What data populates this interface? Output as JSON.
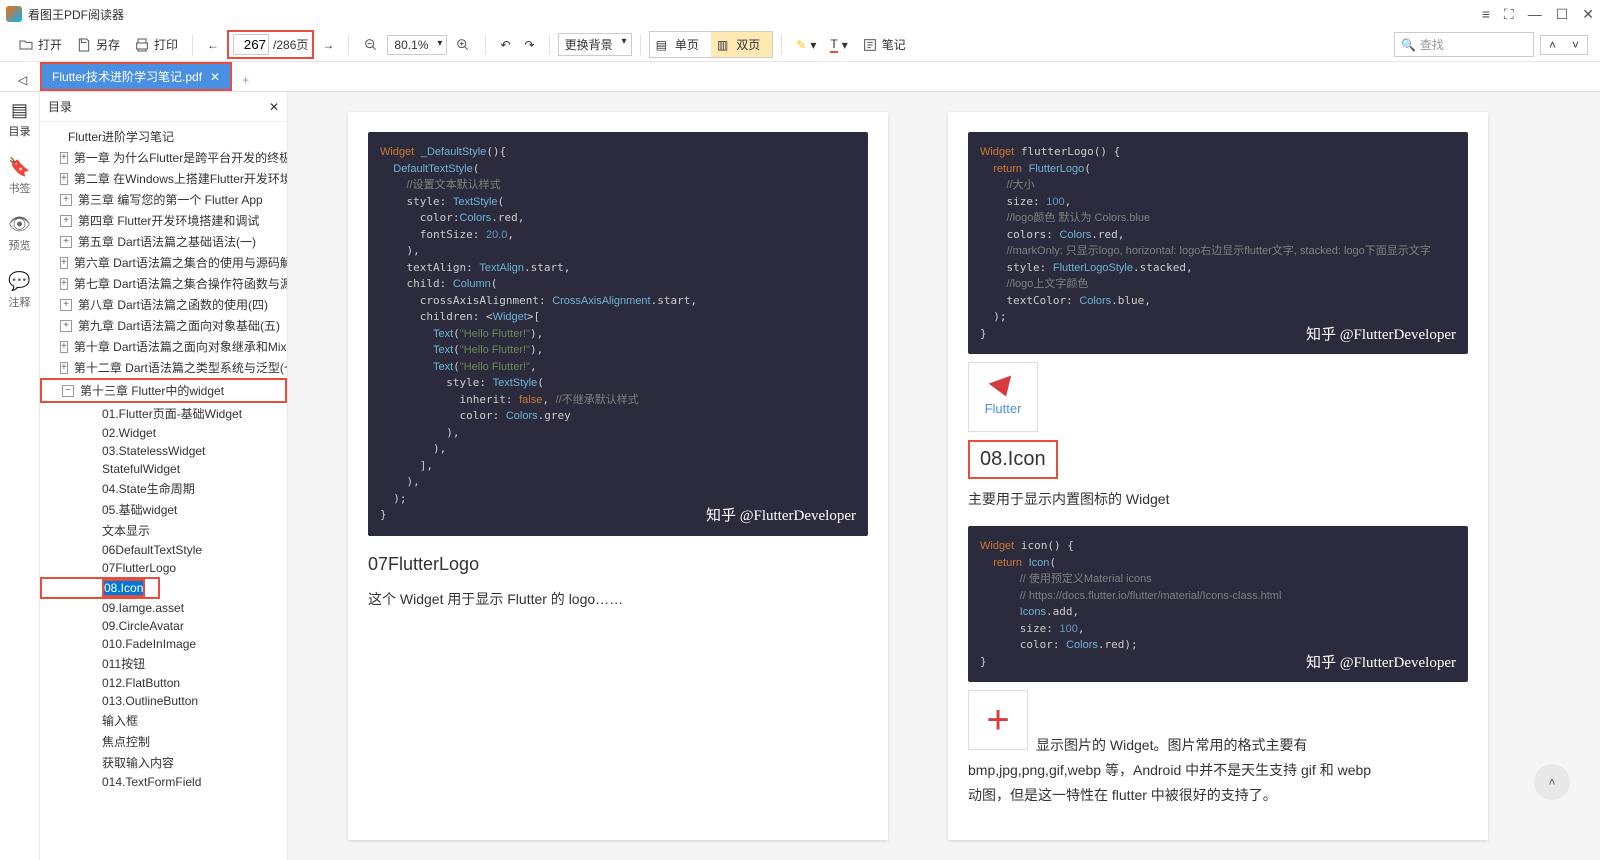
{
  "app_title": "看图王PDF阅读器",
  "toolbar": {
    "open": "打开",
    "save_as": "另存",
    "print": "打印",
    "page_current": "267",
    "page_total": "/286页",
    "zoom": "80.1%",
    "background": "更换背景",
    "single_page": "单页",
    "double_page": "双页",
    "note": "笔记",
    "search_placeholder": "查找"
  },
  "tab": {
    "filename": "Flutter技术进阶学习笔记.pdf"
  },
  "sidebar_icons": {
    "outline": "目录",
    "bookmark": "书签",
    "preview": "预览",
    "annotate": "注释"
  },
  "outline": {
    "title": "目录",
    "root": "Flutter进阶学习笔记",
    "chapters": [
      "第一章 为什么Flutter是跨平台开发的终极之选",
      "第二章 在Windows上搭建Flutter开发环境",
      "第三章 编写您的第一个 Flutter App",
      "第四章 Flutter开发环境搭建和调试",
      "第五章 Dart语法篇之基础语法(一)",
      "第六章 Dart语法篇之集合的使用与源码解析(",
      "第七章 Dart语法篇之集合操作符函数与源码",
      "第八章 Dart语法篇之函数的使用(四)",
      "第九章 Dart语法篇之面向对象基础(五)",
      "第十章 Dart语法篇之面向对象继承和Mixins",
      "第十二章 Dart语法篇之类型系统与泛型(七)"
    ],
    "ch13": "第十三章 Flutter中的widget",
    "ch13_items": [
      "01.Flutter页面-基础Widget",
      "02.Widget",
      "03.StatelessWidget",
      "StatefulWidget",
      "04.State生命周期",
      "05.基础widget",
      "文本显示",
      "06DefaultTextStyle",
      "07FlutterLogo",
      "08.Icon",
      "09.Iamge.asset",
      "09.CircleAvatar",
      "010.FadeInImage",
      "011按钮",
      "012.FlatButton",
      "013.OutlineButton",
      "输入框",
      "焦点控制",
      "获取输入内容",
      "014.TextFormField"
    ]
  },
  "page_left": {
    "h1": "07FlutterLogo",
    "p1": "这个 Widget 用于显示 Flutter 的 logo……",
    "watermark": "知乎 @FlutterDeveloper"
  },
  "page_right": {
    "h1": "08.Icon",
    "p1": "主要用于显示内置图标的 Widget",
    "p2": "显示图片的 Widget。图片常用的格式主要有",
    "p3": "bmp,jpg,png,gif,webp 等，Android 中并不是天生支持 gif 和 webp",
    "p4": "动图，但是这一特性在 flutter 中被很好的支持了。",
    "watermark": "知乎 @FlutterDeveloper",
    "flutter_label": "Flutter"
  }
}
